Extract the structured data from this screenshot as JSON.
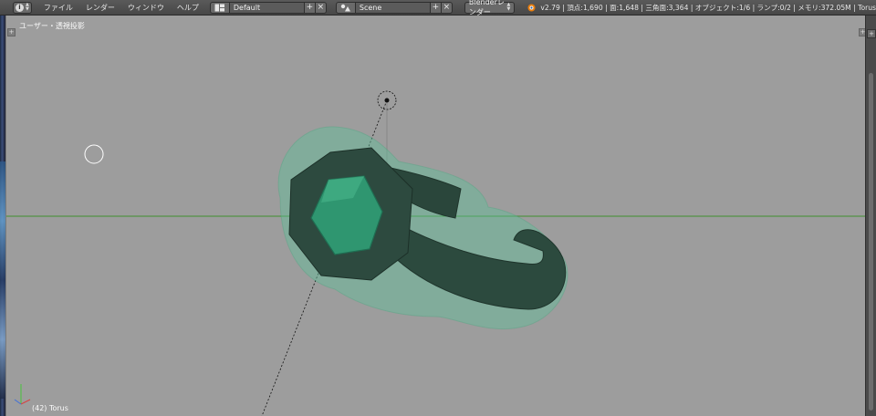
{
  "header": {
    "editor_type_icon": "info-icon",
    "menus": [
      "ファイル",
      "レンダー",
      "ウィンドウ",
      "ヘルプ"
    ],
    "screen_layout": {
      "icon": "layout-icon",
      "value": "Default"
    },
    "scene": {
      "icon": "scene-icon",
      "value": "Scene"
    },
    "render_engine": "Blenderレンダー",
    "logo_icon": "blender-logo-icon",
    "stats": "v2.79 | 頂点:1,690 | 面:1,648 | 三角面:3,364 | オブジェクト:1/6 | ランプ:0/2 | メモリ:372.05M | Torus"
  },
  "viewport": {
    "view_label": "ユーザー・透視投影",
    "object_label": "(42) Torus",
    "background": "#9d9d9d",
    "gem_color": "#2f9670",
    "ring_color": "#2c4a3e",
    "x_axis_color": "#3f8f2f"
  }
}
